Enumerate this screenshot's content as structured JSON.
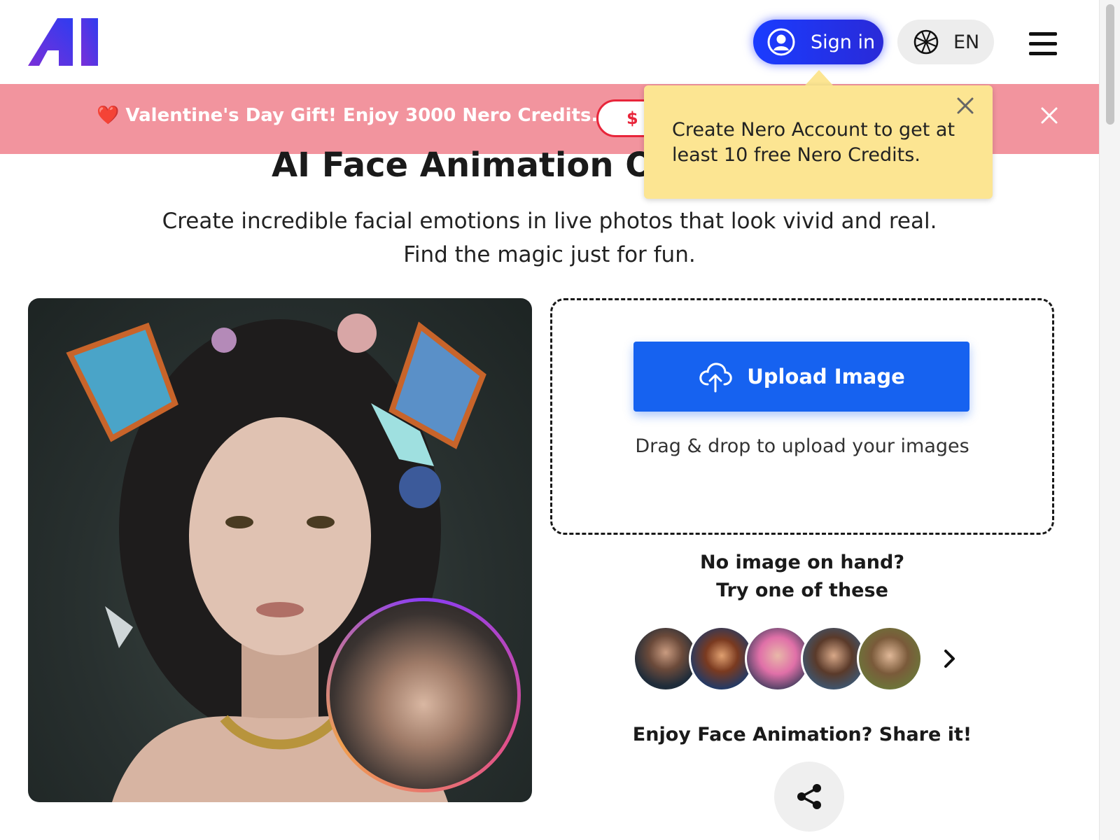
{
  "header": {
    "logo_text": "AI",
    "signin_label": "Sign in",
    "lang_label": "EN"
  },
  "banner": {
    "text": "❤️ Valentine's Day Gift! Enjoy 3000 Nero Credits.❤️",
    "button_label": "$ 0"
  },
  "tooltip": {
    "text": "Create Nero Account to get at least 10 free Nero Credits."
  },
  "hero": {
    "title": "AI Face Animation Onl",
    "subtitle": "Create incredible facial emotions in live photos that look vivid and real. Find the magic just for fun."
  },
  "upload": {
    "button_label": "Upload Image",
    "drag_text": "Drag & drop to upload your images"
  },
  "samples": {
    "heading_line1": "No image on hand?",
    "heading_line2": "Try one of these",
    "count": 5
  },
  "share": {
    "text": "Enjoy Face Animation? Share it!"
  },
  "colors": {
    "accent_blue": "#1662f0",
    "signin_blue": "#1a3cff",
    "banner_pink": "#f2949e",
    "tooltip_yellow": "#fce592",
    "badge_red": "#e8253a"
  },
  "icons": [
    "ai-logo",
    "user-icon",
    "globe-icon",
    "hamburger-menu-icon",
    "close-icon",
    "cloud-upload-icon",
    "chevron-right-icon",
    "share-icon"
  ]
}
